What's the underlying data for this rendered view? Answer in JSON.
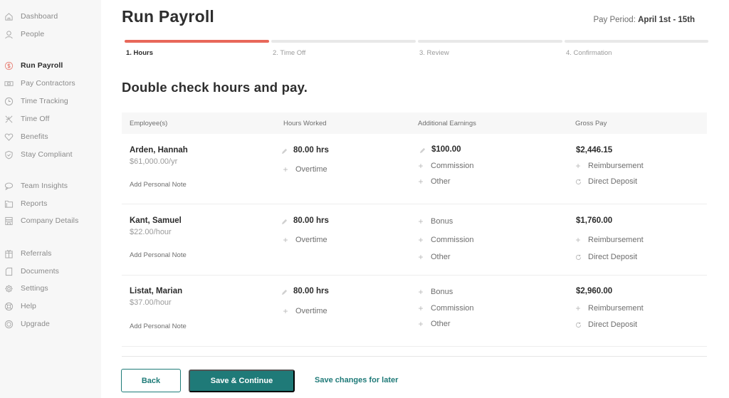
{
  "sidebar": {
    "items": [
      {
        "label": "Dashboard",
        "icon": "home-icon",
        "active": false
      },
      {
        "label": "People",
        "icon": "person-icon",
        "active": false
      },
      {
        "label": "Run Payroll",
        "icon": "dollar-circle-icon",
        "active": true
      },
      {
        "label": "Pay Contractors",
        "icon": "cash-icon",
        "active": false
      },
      {
        "label": "Time Tracking",
        "icon": "clock-icon",
        "active": false
      },
      {
        "label": "Time Off",
        "icon": "airplane-icon",
        "active": false
      },
      {
        "label": "Benefits",
        "icon": "heart-icon",
        "active": false
      },
      {
        "label": "Stay Compliant",
        "icon": "shield-check-icon",
        "active": false
      },
      {
        "label": "Team Insights",
        "icon": "chat-bubble-icon",
        "active": false
      },
      {
        "label": "Reports",
        "icon": "folder-icon",
        "active": false
      },
      {
        "label": "Company Details",
        "icon": "store-icon",
        "active": false
      },
      {
        "label": "Referrals",
        "icon": "gift-icon",
        "active": false
      },
      {
        "label": "Documents",
        "icon": "document-icon",
        "active": false
      },
      {
        "label": "Settings",
        "icon": "gear-icon",
        "active": false
      },
      {
        "label": "Help",
        "icon": "lifebuoy-icon",
        "active": false
      },
      {
        "label": "Upgrade",
        "icon": "upgrade-icon",
        "active": false
      }
    ]
  },
  "header": {
    "title": "Run Payroll",
    "pay_period_label": "Pay Period:",
    "pay_period_value": "April 1st - 15th"
  },
  "steps": [
    {
      "label": "1. Hours",
      "active": true
    },
    {
      "label": "2. Time Off",
      "active": false
    },
    {
      "label": "3. Review",
      "active": false
    },
    {
      "label": "4. Confirmation",
      "active": false
    }
  ],
  "section_title": "Double check hours and pay.",
  "table": {
    "columns": [
      "Employee(s)",
      "Hours Worked",
      "Additional Earnings",
      "Gross Pay"
    ],
    "rows": [
      {
        "name": "Arden, Hannah",
        "rate": "$61,000.00/yr",
        "note_link": "Add Personal Note",
        "hours": "80.00 hrs",
        "hours_options": [
          "Overtime"
        ],
        "earnings_value": "$100.00",
        "earnings_options": [
          "Commission",
          "Other"
        ],
        "gross_pay": "$2,446.15",
        "gross_options": [
          "Reimbursement",
          "Direct Deposit"
        ]
      },
      {
        "name": "Kant, Samuel",
        "rate": "$22.00/hour",
        "note_link": "Add Personal Note",
        "hours": "80.00 hrs",
        "hours_options": [
          "Overtime"
        ],
        "earnings_options": [
          "Bonus",
          "Commission",
          "Other"
        ],
        "gross_pay": "$1,760.00",
        "gross_options": [
          "Reimbursement",
          "Direct Deposit"
        ]
      },
      {
        "name": "Listat, Marian",
        "rate": "$37.00/hour",
        "note_link": "Add Personal Note",
        "hours": "80.00 hrs",
        "hours_options": [
          "Overtime"
        ],
        "earnings_options": [
          "Bonus",
          "Commission",
          "Other"
        ],
        "gross_pay": "$2,960.00",
        "gross_options": [
          "Reimbursement",
          "Direct Deposit"
        ]
      }
    ]
  },
  "footer": {
    "back_label": "Back",
    "save_continue_label": "Save & Continue",
    "save_later_label": "Save changes for later"
  },
  "colors": {
    "accent": "#e8685a",
    "primary": "#1f7a78"
  }
}
